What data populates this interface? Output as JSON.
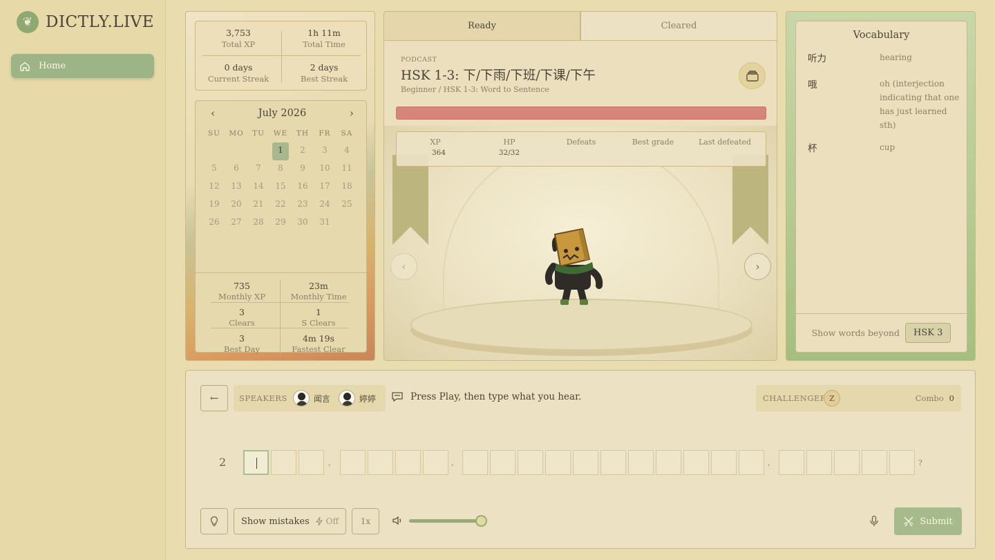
{
  "brand": {
    "name": "DICTLY.LIVE"
  },
  "sidebar": {
    "home_label": "Home"
  },
  "stats": {
    "total_xp": {
      "value": "3,753",
      "label": "Total XP"
    },
    "total_time": {
      "value": "1h 11m",
      "label": "Total Time"
    },
    "current_streak": {
      "value": "0 days",
      "label": "Current Streak"
    },
    "best_streak": {
      "value": "2 days",
      "label": "Best Streak"
    }
  },
  "calendar": {
    "title": "July 2026",
    "weekdays": [
      "SU",
      "MO",
      "TU",
      "WE",
      "TH",
      "FR",
      "SA"
    ],
    "days": [
      "1",
      "2",
      "3",
      "4",
      "5",
      "6",
      "7",
      "8",
      "9",
      "10",
      "11",
      "12",
      "13",
      "14",
      "15",
      "16",
      "17",
      "18",
      "19",
      "20",
      "21",
      "22",
      "23",
      "24",
      "25",
      "26",
      "27",
      "28",
      "29",
      "30",
      "31"
    ],
    "first_weekday_index": 3,
    "today": "1"
  },
  "monthly": {
    "xp": {
      "value": "735",
      "label": "Monthly XP"
    },
    "time": {
      "value": "23m",
      "label": "Monthly Time"
    },
    "clears": {
      "value": "3",
      "label": "Clears"
    },
    "s_clears": {
      "value": "1",
      "label": "S Clears"
    },
    "best_day": {
      "value": "3",
      "label": "Best Day"
    },
    "fastest": {
      "value": "4m 19s",
      "label": "Fastest Clear"
    }
  },
  "tabs": {
    "ready": "Ready",
    "cleared": "Cleared"
  },
  "podcast": {
    "label": "PODCAST",
    "title": "HSK 1-3: 下/下雨/下班/下课/下午",
    "subtitle": "Beginner / HSK 1-3: Word to Sentence"
  },
  "monster_stats": {
    "xp_label": "XP",
    "xp_value": "364",
    "hp_label": "HP",
    "hp_value": "32/32",
    "defeats_label": "Defeats",
    "best_grade_label": "Best grade",
    "last_defeated_label": "Last defeated",
    "hp_fraction": 1.0
  },
  "vocab": {
    "title": "Vocabulary",
    "items": [
      {
        "word": "听力",
        "meaning": "hearing"
      },
      {
        "word": "哦",
        "meaning": "oh (interjection indicating that one has just learned sth)"
      },
      {
        "word": "杯",
        "meaning": "cup"
      }
    ],
    "footer_label": "Show words beyond",
    "level_button": "HSK 3"
  },
  "player": {
    "speakers_label": "SPEAKERS",
    "speaker_1": "闻言",
    "speaker_2": "婷婷",
    "instruction": "Press Play, then type what you hear.",
    "challenger_label": "CHALLENGER",
    "challenger_initial": "Z",
    "combo_label": "Combo",
    "combo_value": "0",
    "line_number": "2",
    "punct_1": ",",
    "punct_2": ",",
    "punct_3": ",",
    "punct_end": "?",
    "show_mistakes_label": "Show mistakes",
    "show_mistakes_state": "Off",
    "speed_label": "1x",
    "volume_fraction": 0.98,
    "submit_label": "Submit"
  },
  "icons": [
    "home-icon",
    "chevron-left-icon",
    "chevron-right-icon",
    "stack-icon",
    "arrow-left-icon",
    "chat-icon",
    "lightbulb-icon",
    "bolt-icon",
    "volume-icon",
    "mic-icon",
    "swords-icon"
  ]
}
